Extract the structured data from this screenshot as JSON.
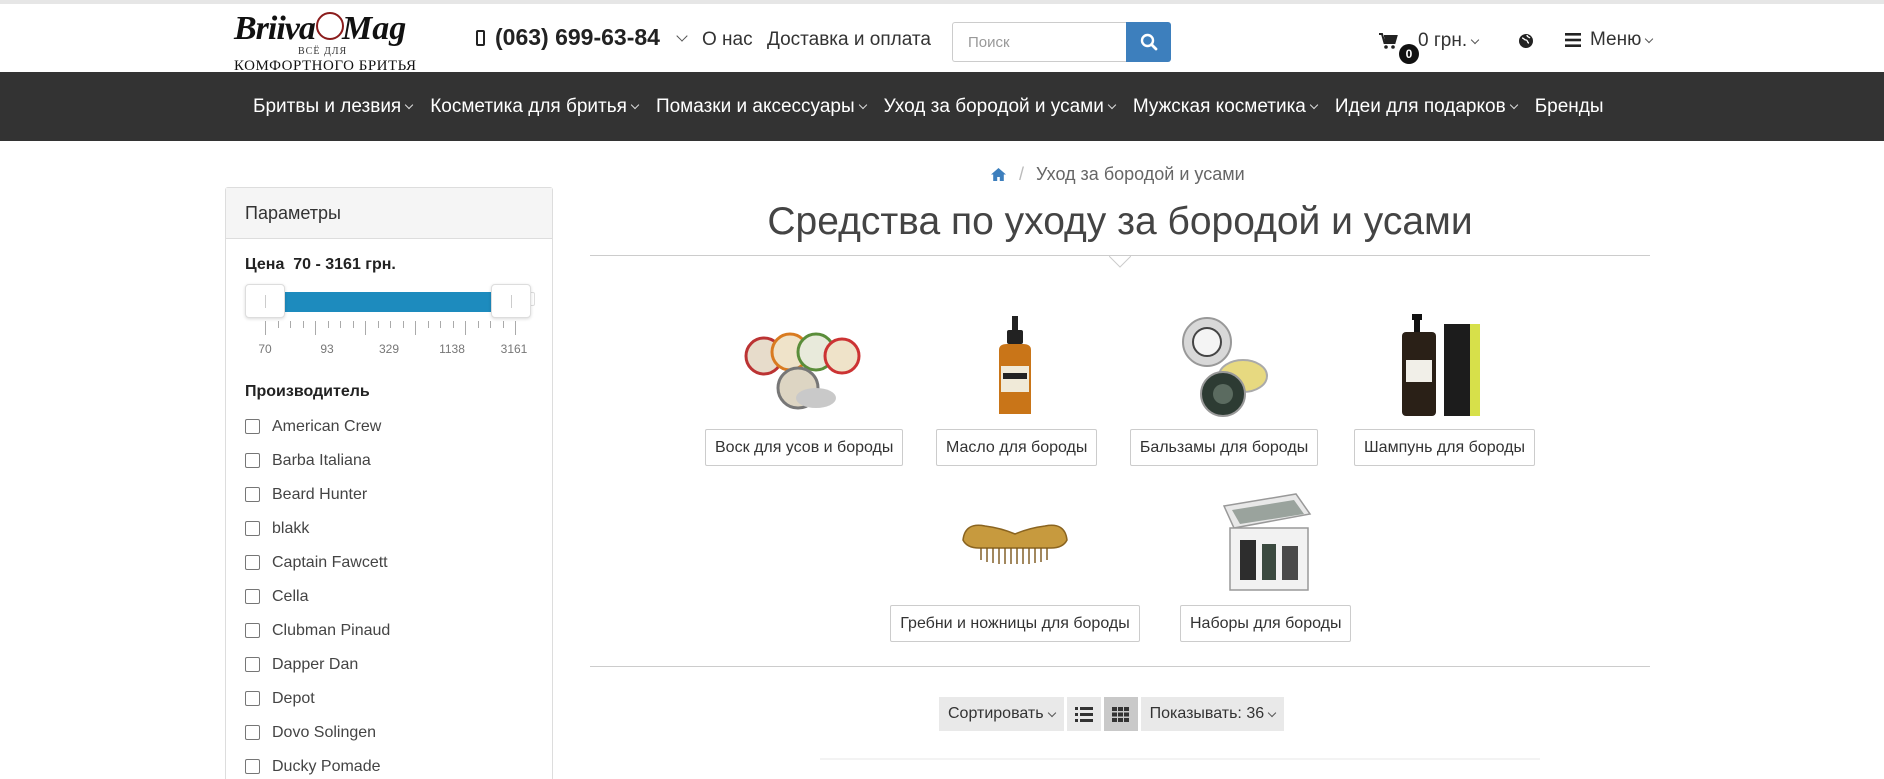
{
  "header": {
    "logo": {
      "line1a": "Briiva",
      "line1b": "Mag",
      "line2": "ВСЁ ДЛЯ",
      "line3": "КОМФОРТНОГО БРИТЬЯ"
    },
    "phone": "(063) 699-63-84",
    "links": [
      "О нас",
      "Доставка и оплата"
    ],
    "search": {
      "placeholder": "Поиск",
      "value": ""
    },
    "cart": {
      "count": "0",
      "total": "0 грн."
    },
    "menu_label": "Меню"
  },
  "nav": {
    "items": [
      {
        "label": "Бритвы и лезвия",
        "dropdown": true
      },
      {
        "label": "Косметика для бритья",
        "dropdown": true
      },
      {
        "label": "Помазки и аксессуары",
        "dropdown": true
      },
      {
        "label": "Уход за бородой и усами",
        "dropdown": true
      },
      {
        "label": "Мужская косметика",
        "dropdown": true
      },
      {
        "label": "Идеи для подарков",
        "dropdown": true
      },
      {
        "label": "Бренды",
        "dropdown": false
      }
    ]
  },
  "breadcrumb": {
    "current": "Уход за бородой и усами"
  },
  "page_title": "Средства по уходу за бородой и усами",
  "sidebar": {
    "title": "Параметры",
    "price": {
      "label": "Цена",
      "range": "70 - 3161 грн.",
      "min": 70,
      "max": 3161,
      "tick_labels": [
        "70",
        "93",
        "329",
        "1138",
        "3161"
      ]
    },
    "maker_title": "Производитель",
    "makers": [
      "American Crew",
      "Barba Italiana",
      "Beard Hunter",
      "blakk",
      "Captain Fawcett",
      "Cella",
      "Clubman Pinaud",
      "Dapper Dan",
      "Depot",
      "Dovo Solingen",
      "Ducky Pomade"
    ]
  },
  "categories": [
    {
      "label": "Воск для усов и бороды"
    },
    {
      "label": "Масло для бороды"
    },
    {
      "label": "Бальзамы для бороды"
    },
    {
      "label": "Шампунь для бороды"
    },
    {
      "label": "Гребни и ножницы для бороды"
    },
    {
      "label": "Наборы для бороды"
    }
  ],
  "toolbar": {
    "sort_label": "Сортировать",
    "show_label": "Показывать: 36",
    "active_view": "grid"
  },
  "colors": {
    "nav_bg": "#333333",
    "accent": "#3d7fbd",
    "slider": "#1d8bbe"
  }
}
